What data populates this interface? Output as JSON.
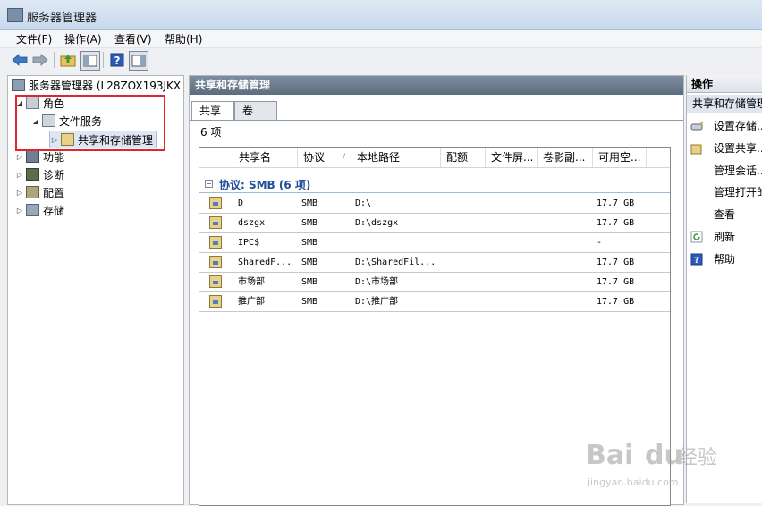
{
  "window": {
    "title": "服务器管理器"
  },
  "menu": [
    "文件(F)",
    "操作(A)",
    "查看(V)",
    "帮助(H)"
  ],
  "tree": {
    "root": "服务器管理器 (L28ZOX193JKX",
    "roles": "角色",
    "file_services": "文件服务",
    "share_mgmt": "共享和存储管理",
    "features": "功能",
    "diagnostics": "诊断",
    "config": "配置",
    "storage": "存储"
  },
  "center": {
    "header": "共享和存储管理",
    "tabs": [
      "共享",
      "卷"
    ],
    "count": "6 项",
    "columns": [
      "共享名",
      "协议",
      "本地路径",
      "配额",
      "文件屏...",
      "卷影副...",
      "可用空..."
    ],
    "group_label": "协议: SMB (6 项)",
    "rows": [
      {
        "name": "D",
        "protocol": "SMB",
        "path": "D:\\",
        "free": "17.7 GB"
      },
      {
        "name": "dszgx",
        "protocol": "SMB",
        "path": "D:\\dszgx",
        "free": "17.7 GB"
      },
      {
        "name": "IPC$",
        "protocol": "SMB",
        "path": "",
        "free": "-"
      },
      {
        "name": "SharedF...",
        "protocol": "SMB",
        "path": "D:\\SharedFil...",
        "free": "17.7 GB"
      },
      {
        "name": "市场部",
        "protocol": "SMB",
        "path": "D:\\市场部",
        "free": "17.7 GB"
      },
      {
        "name": "推广部",
        "protocol": "SMB",
        "path": "D:\\推广部",
        "free": "17.7 GB"
      }
    ]
  },
  "actions": {
    "header": "操作",
    "section": "共享和存储管理",
    "items": [
      "设置存储...",
      "设置共享...",
      "管理会话...",
      "管理打开的",
      "查看",
      "刷新",
      "帮助"
    ]
  },
  "watermark": {
    "brand": "Bai",
    "brand2": "du",
    "suffix": "经验",
    "url": "jingyan.baidu.com"
  },
  "colors": {
    "accent": "#1f4f9a",
    "highlight_box": "#e0252b",
    "pane_header": "#6b7a8d"
  }
}
